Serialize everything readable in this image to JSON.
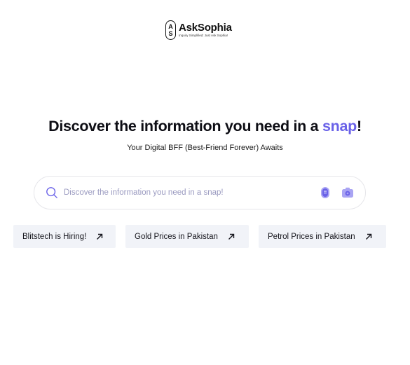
{
  "logo": {
    "mark_top": "A",
    "mark_bottom": "S",
    "name": "AskSophia",
    "tagline": "Inquiry Simplified: Just Ask Sophia!"
  },
  "hero": {
    "headline_before": "Discover the information you need in a ",
    "headline_accent": "snap",
    "headline_after": "!",
    "subtitle": "Your Digital BFF (Best-Friend Forever) Awaits"
  },
  "search": {
    "placeholder": "Discover the information you need in a snap!",
    "value": "",
    "icons": {
      "search": "search-icon",
      "voice": "microphone-icon",
      "camera": "camera-icon"
    }
  },
  "suggestions": [
    {
      "label": "Blitstech is Hiring!",
      "icon": "arrow-up-right-icon"
    },
    {
      "label": "Gold Prices in Pakistan",
      "icon": "arrow-up-right-icon"
    },
    {
      "label": "Petrol Prices in Pakistan",
      "icon": "arrow-up-right-icon"
    }
  ],
  "colors": {
    "accent": "#6a62e8",
    "accent_light": "#a9a4f3",
    "chip_bg": "#f1f3f8",
    "text": "#0d0d14"
  }
}
